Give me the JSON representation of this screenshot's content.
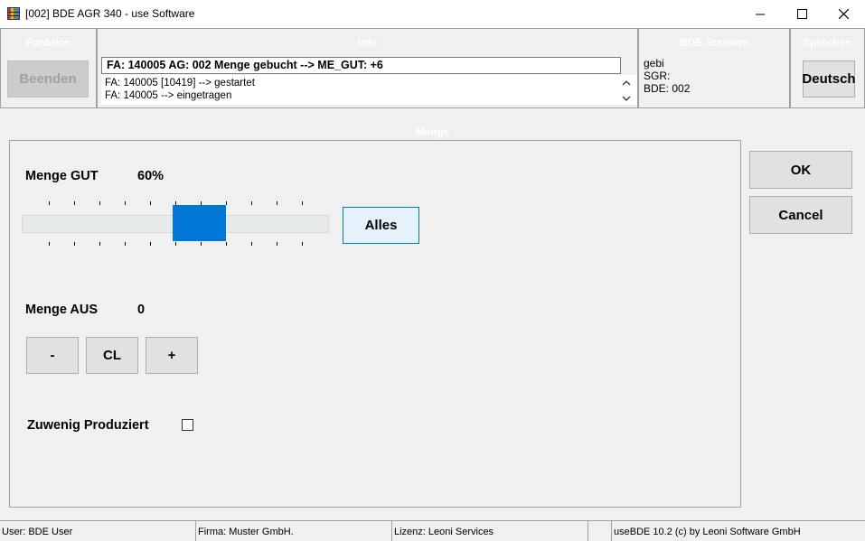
{
  "window": {
    "title": "[002] BDE AGR 340 - use Software",
    "controls": {
      "minimize": "minimize",
      "maximize": "maximize",
      "close": "close"
    }
  },
  "panels": {
    "funktion": {
      "title": "Funktion",
      "button_label": "Beenden"
    },
    "info": {
      "title": "Info",
      "current_message": "FA: 140005 AG: 002 Menge gebucht --> ME_GUT: +6",
      "log": [
        "FA: 140005 [10419] --> gestartet",
        "FA: 140005 --> eingetragen"
      ]
    },
    "bde_station": {
      "title": "BDE Statinon",
      "lines": [
        "gebi",
        "SGR:",
        "BDE: 002"
      ]
    },
    "sprachen": {
      "title": "Sprachen",
      "button_label": "Deutsch"
    }
  },
  "menge": {
    "section_title": "Menge",
    "gut": {
      "label": "Menge GUT",
      "value_text": "60%",
      "slider_value": 0.6,
      "alles_label": "Alles"
    },
    "aus": {
      "label": "Menge AUS",
      "value": "0",
      "minus_label": "-",
      "clear_label": "CL",
      "plus_label": "+"
    },
    "zuwenig": {
      "label": "Zuwenig Produziert",
      "checked": false
    }
  },
  "actions": {
    "ok_label": "OK",
    "cancel_label": "Cancel"
  },
  "statusbar": {
    "user": "User: BDE User",
    "firma": "Firma: Muster GmbH.",
    "lizenz": "Lizenz: Leoni Services",
    "empty": "",
    "copyright": "useBDE 10.2 (c) by Leoni Software GmbH"
  },
  "colors": {
    "accent": "#0078d7",
    "accent_light": "#e5f1fb",
    "panel_title": "#ffffff",
    "background": "#f0f0f0"
  }
}
